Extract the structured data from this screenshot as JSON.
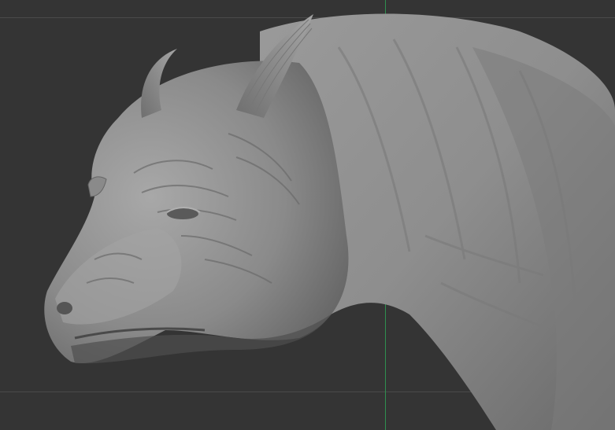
{
  "viewport": {
    "background": "#343434",
    "grid_color": "#4a4a4a",
    "axis_color": "#2f8f4f"
  },
  "model": {
    "name": "creature-head-sculpt",
    "material_color": "#8c8c8c",
    "shadow_color": "#4a4a4a",
    "highlight_color": "#b5b5b5"
  }
}
